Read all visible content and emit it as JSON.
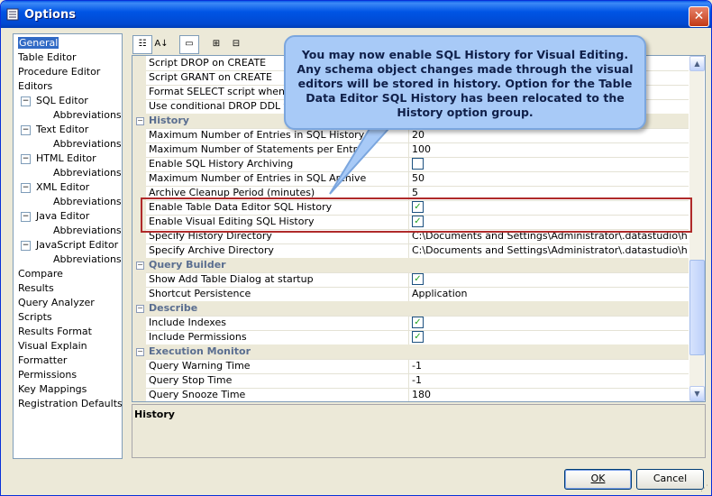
{
  "window": {
    "title": "Options",
    "close_label": "✕"
  },
  "nav": [
    {
      "label": "General",
      "indent": 0,
      "selected": true
    },
    {
      "label": "Table Editor",
      "indent": 0
    },
    {
      "label": "Procedure Editor",
      "indent": 0
    },
    {
      "label": "Editors",
      "indent": 0
    },
    {
      "label": "SQL Editor",
      "indent": 1,
      "exp": "⊟"
    },
    {
      "label": "Abbreviations",
      "indent": 2
    },
    {
      "label": "Text Editor",
      "indent": 1,
      "exp": "⊟"
    },
    {
      "label": "Abbreviations",
      "indent": 2
    },
    {
      "label": "HTML Editor",
      "indent": 1,
      "exp": "⊟"
    },
    {
      "label": "Abbreviations",
      "indent": 2
    },
    {
      "label": "XML Editor",
      "indent": 1,
      "exp": "⊟"
    },
    {
      "label": "Abbreviations",
      "indent": 2
    },
    {
      "label": "Java Editor",
      "indent": 1,
      "exp": "⊟"
    },
    {
      "label": "Abbreviations",
      "indent": 2
    },
    {
      "label": "JavaScript Editor",
      "indent": 1,
      "exp": "⊟"
    },
    {
      "label": "Abbreviations",
      "indent": 2
    },
    {
      "label": "Compare",
      "indent": 0
    },
    {
      "label": "Results",
      "indent": 0
    },
    {
      "label": "Query Analyzer",
      "indent": 0
    },
    {
      "label": "Scripts",
      "indent": 0
    },
    {
      "label": "Results Format",
      "indent": 0
    },
    {
      "label": "Visual Explain",
      "indent": 0
    },
    {
      "label": "Formatter",
      "indent": 0
    },
    {
      "label": "Permissions",
      "indent": 0
    },
    {
      "label": "Key Mappings",
      "indent": 0
    },
    {
      "label": "Registration Defaults",
      "indent": 0
    }
  ],
  "toolbar": [
    {
      "name": "categorized-view-icon",
      "glyph": "☷",
      "pressed": true
    },
    {
      "name": "alphabetical-sort-icon",
      "glyph": "A↓",
      "pressed": false
    },
    {
      "name": "property-pages-icon",
      "glyph": "▭",
      "pressed": true
    },
    {
      "name": "expand-all-icon",
      "glyph": "⊞",
      "pressed": false
    },
    {
      "name": "collapse-all-icon",
      "glyph": "⊟",
      "pressed": false
    }
  ],
  "rows": [
    {
      "type": "prop",
      "name": "Script DROP on CREATE",
      "value": ""
    },
    {
      "type": "prop",
      "name": "Script GRANT on CREATE",
      "value": ""
    },
    {
      "type": "prop",
      "name": "Format SELECT script when scripting",
      "value": ""
    },
    {
      "type": "prop",
      "name": "Use conditional DROP DDL for Tables",
      "value": ""
    },
    {
      "type": "cat",
      "name": "History"
    },
    {
      "type": "prop",
      "name": "Maximum Number of Entries in SQL History",
      "value": "20"
    },
    {
      "type": "prop",
      "name": "Maximum Number of Statements per Entry",
      "value": "100"
    },
    {
      "type": "prop",
      "name": "Enable SQL History Archiving",
      "check": false
    },
    {
      "type": "prop",
      "name": "Maximum Number of Entries in SQL Archive",
      "value": "50"
    },
    {
      "type": "prop",
      "name": "Archive Cleanup Period (minutes)",
      "value": "5"
    },
    {
      "type": "prop",
      "name": "Enable Table Data Editor SQL History",
      "check": true
    },
    {
      "type": "prop",
      "name": "Enable Visual Editing SQL History",
      "check": true
    },
    {
      "type": "prop",
      "name": "Specify History Directory",
      "value": "C:\\Documents and Settings\\Administrator\\.datastudio\\history"
    },
    {
      "type": "prop",
      "name": "Specify Archive Directory",
      "value": "C:\\Documents and Settings\\Administrator\\.datastudio\\histor..."
    },
    {
      "type": "cat",
      "name": "Query Builder"
    },
    {
      "type": "prop",
      "name": "Show Add Table Dialog at startup",
      "check": true
    },
    {
      "type": "prop",
      "name": "Shortcut Persistence",
      "value": "Application"
    },
    {
      "type": "cat",
      "name": "Describe"
    },
    {
      "type": "prop",
      "name": "Include Indexes",
      "check": true
    },
    {
      "type": "prop",
      "name": "Include Permissions",
      "check": true
    },
    {
      "type": "cat",
      "name": "Execution Monitor"
    },
    {
      "type": "prop",
      "name": "Query Warning Time",
      "value": "-1"
    },
    {
      "type": "prop",
      "name": "Query Stop Time",
      "value": "-1"
    },
    {
      "type": "prop",
      "name": "Query Snooze Time",
      "value": "180"
    }
  ],
  "description": {
    "title": "History"
  },
  "callout": {
    "text": "You may now enable SQL History for Visual Editing. Any schema object changes made through the visual editors will be stored in history. Option for the Table Data Editor SQL History has been relocated to the History option group."
  },
  "buttons": {
    "ok": "OK",
    "cancel": "Cancel"
  },
  "colors": {
    "title_bar": "#0055E5",
    "selection": "#316AC5",
    "highlight_box": "#B02A2A",
    "callout_fill": "#A8CAF7",
    "check_mark": "#21A121"
  }
}
